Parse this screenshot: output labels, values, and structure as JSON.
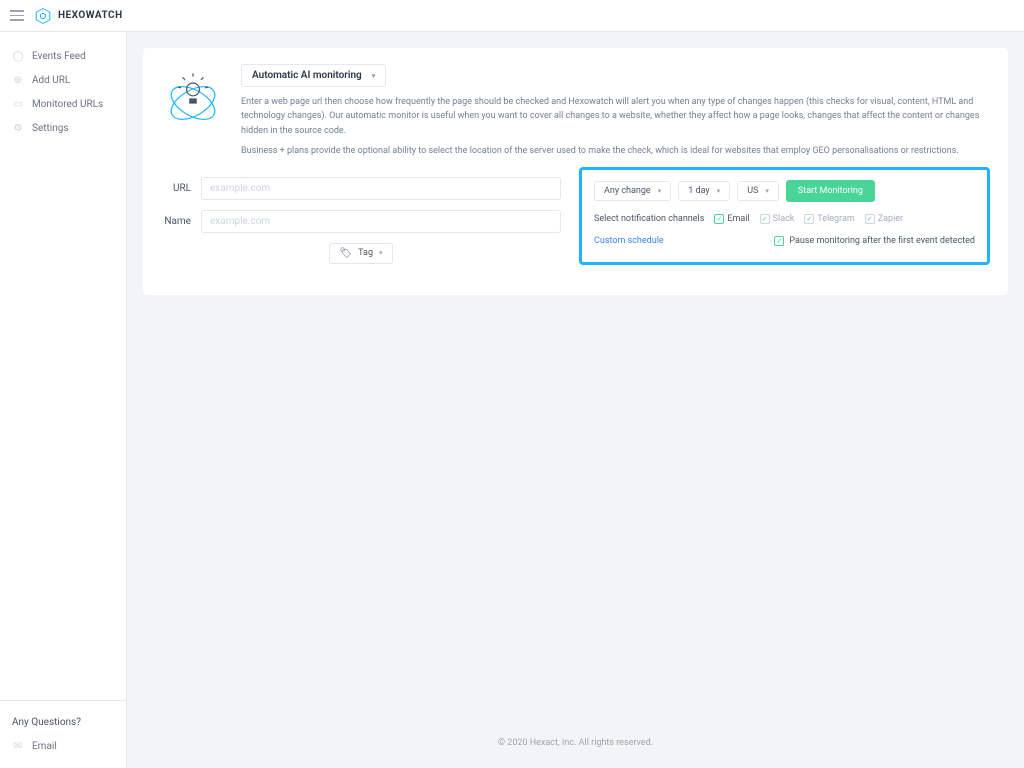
{
  "brand": "HEXOWATCH",
  "sidebar": {
    "items": [
      {
        "label": "Events Feed"
      },
      {
        "label": "Add URL"
      },
      {
        "label": "Monitored URLs"
      },
      {
        "label": "Settings"
      }
    ],
    "question": "Any Questions?",
    "contact": "Email"
  },
  "monitor": {
    "type_label": "Automatic AI monitoring",
    "desc1": "Enter a web page url then choose how frequently the page should be checked and Hexowatch will alert you when any type of changes happen (this checks for visual, content, HTML and technology changes). Our automatic monitor is useful when you want to cover all changes to a website, whether they affect how a page looks, changes that affect the content or changes hidden in the source code.",
    "desc2": "Business + plans provide the optional ability to select the location of the server used to make the check, which is ideal for websites that employ GEO personalisations or restrictions."
  },
  "fields": {
    "url_label": "URL",
    "url_placeholder": "example.com",
    "name_label": "Name",
    "name_placeholder": "example.com",
    "tag_label": "Tag"
  },
  "options": {
    "change": "Any change",
    "freq": "1 day",
    "region": "US",
    "start": "Start Monitoring",
    "notif_label": "Select notification channels",
    "channels": {
      "email": "Email",
      "slack": "Slack",
      "telegram": "Telegram",
      "zapier": "Zapier"
    },
    "custom": "Custom schedule",
    "pause": "Pause monitoring after the first event detected"
  },
  "footer": "© 2020 Hexact, Inc. All rights reserved."
}
